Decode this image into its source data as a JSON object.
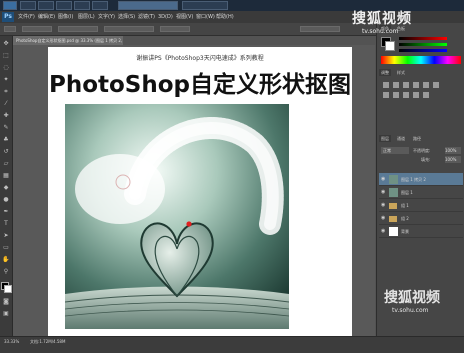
{
  "taskbar": {
    "items": [
      "",
      "",
      "",
      "",
      "",
      "",
      "",
      ""
    ]
  },
  "menubar": {
    "app_icon": "Ps",
    "items": [
      "文件(F)",
      "编辑(E)",
      "图像(I)",
      "图层(L)",
      "文字(Y)",
      "选择(S)",
      "滤镜(T)",
      "3D(D)",
      "视图(V)",
      "窗口(W)",
      "帮助(H)"
    ]
  },
  "document": {
    "tab_label": "PhotoShop自定义形状抠图.psd @ 33.3% (图层 1 拷贝 2, RGB/8)",
    "subtitle": "谢振讲PS《PhotoShop3天闪电速成》系列教程",
    "title": "PhotoShop自定义形状抠图"
  },
  "status": {
    "zoom": "33.33%",
    "doc_info": "文档:1.72M/4.58M"
  },
  "panels": {
    "color_tabs": [
      "颜色",
      "色板"
    ],
    "adjust_tabs": [
      "调整",
      "样式"
    ],
    "layers_tabs": [
      "图层",
      "通道",
      "路径"
    ],
    "blend_mode": "正常",
    "opacity_label": "不透明度:",
    "opacity_value": "100%",
    "fill_label": "填充:",
    "fill_value": "100%",
    "layers": [
      {
        "name": "图层 1 拷贝 2"
      },
      {
        "name": "图层 1"
      },
      {
        "name": "组 1"
      },
      {
        "name": "组 2"
      },
      {
        "name": "背景"
      }
    ]
  },
  "watermark": {
    "top_text": "搜狐视频",
    "top_url": "tv.sohu.com",
    "bottom_text": "搜狐视频",
    "bottom_url": "tv.sohu.com"
  },
  "colors": {
    "accent": "#1e4e79",
    "ui_dark": "#3a3a3a",
    "canvas_bg": "#595959",
    "marker_red": "#e02020"
  }
}
